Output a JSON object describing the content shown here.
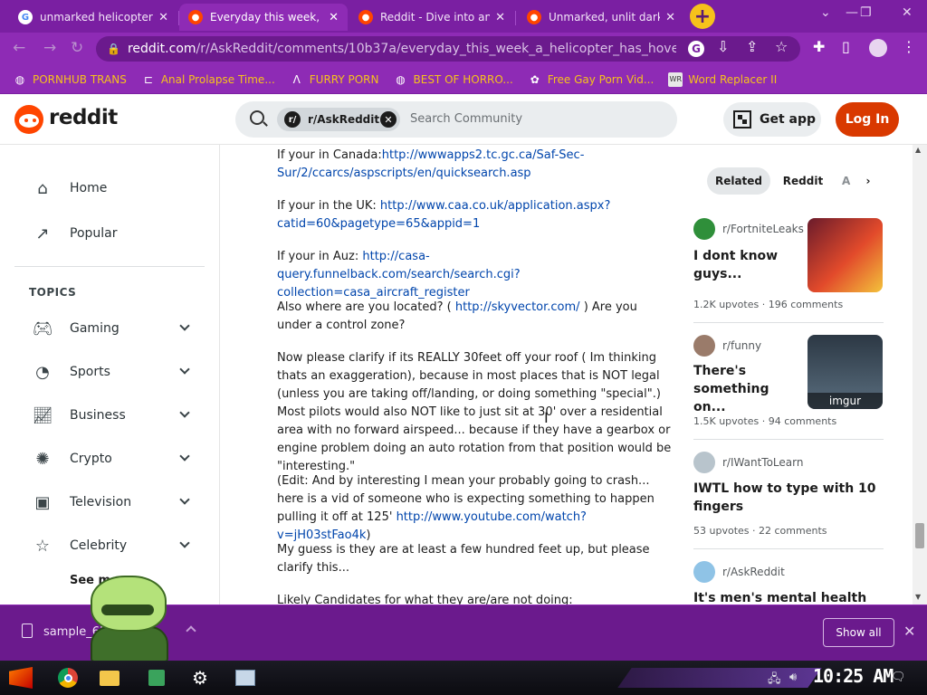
{
  "browser": {
    "tabs": [
      {
        "title": "unmarked helicopter",
        "icon": "google-icon",
        "active": false
      },
      {
        "title": "Everyday this week, a",
        "icon": "reddit-icon",
        "active": true
      },
      {
        "title": "Reddit - Dive into an",
        "icon": "reddit-icon",
        "active": false
      },
      {
        "title": "Unmarked, unlit dark",
        "icon": "reddit-icon",
        "active": false
      }
    ],
    "new_tab": "+",
    "url_host": "reddit.com",
    "url_path": "/r/AskReddit/comments/10b37a/everyday_this_week_a_helicopter_has_hover...",
    "bookmarks": [
      {
        "label": "PORNHUB TRANS",
        "icon": "globe-icon"
      },
      {
        "label": "Anal Prolapse Time...",
        "icon": "bookmark-icon"
      },
      {
        "label": "FURRY PORN",
        "icon": "caret-logo-icon"
      },
      {
        "label": "BEST OF HORRO...",
        "icon": "globe-icon"
      },
      {
        "label": "Free Gay Porn Vid...",
        "icon": "puzzle-icon"
      },
      {
        "label": "Word Replacer II",
        "icon": "wr-icon"
      }
    ]
  },
  "reddit": {
    "brand": "reddit",
    "search_chip": "r/AskReddit",
    "search_placeholder": "Search Community",
    "get_app": "Get app",
    "login": "Log In",
    "nav": {
      "home": "Home",
      "popular": "Popular",
      "topics_heading": "TOPICS",
      "topics": [
        "Gaming",
        "Sports",
        "Business",
        "Crypto",
        "Television",
        "Celebrity"
      ],
      "see_more": "See more"
    },
    "comment": {
      "p1_prefix": "If your in Canada:",
      "p1_link": "http://wwwapps2.tc.gc.ca/Saf-Sec-Sur/2/ccarcs/aspscripts/en/quicksearch.asp",
      "p2_prefix": "If your in the UK: ",
      "p2_link": "http://www.caa.co.uk/application.aspx?catid=60&pagetype=65&appid=1",
      "p3_prefix": "If your in Auz: ",
      "p3_link": "http://casa-query.funnelback.com/search/search.cgi?collection=casa_aircraft_register",
      "p4_prefix": "Also where are you located? ( ",
      "p4_link": "http://skyvector.com/",
      "p4_suffix": " ) Are you under a control zone?",
      "p5": "Now please clarify if its REALLY 30feet off your roof ( Im thinking thats an exaggeration), because in most places that is NOT legal (unless you are taking off/landing, or doing something \"special\".) Most pilots would also NOT like to just sit at 30' over a residential area with no forward airspeed... because if they have a gearbox or engine problem doing an auto rotation from that position would be \"interesting.\"",
      "p6_prefix": "(Edit: And by interesting I mean your probably going to crash... here is a vid of someone who is expecting something to happen pulling it off at 125' ",
      "p6_link": "http://www.youtube.com/watch?v=jH03stFao4k",
      "p6_suffix": ")",
      "p7": "My guess is they are at least a few hundred feet up, but please clarify this...",
      "p8": "Likely Candidates for what they are/are not doing:"
    },
    "related": {
      "tabs": [
        "Related",
        "Reddit",
        "A"
      ],
      "posts": [
        {
          "sub": "r/FortniteLeaks",
          "title": "I dont know guys...",
          "upvotes": "1.2K upvotes",
          "comments": "196 comments",
          "thumb_label": ""
        },
        {
          "sub": "r/funny",
          "title": "There's something on...",
          "upvotes": "1.5K upvotes",
          "comments": "94 comments",
          "thumb_label": "imgur"
        },
        {
          "sub": "r/IWantToLearn",
          "title": "IWTL how to type with 10 fingers",
          "upvotes": "53 upvotes",
          "comments": "22 comments",
          "thumb_label": ""
        },
        {
          "sub": "r/AskReddit",
          "title": "It's men's mental health",
          "upvotes": "",
          "comments": "",
          "thumb_label": ""
        }
      ]
    }
  },
  "downloads": {
    "file": "sample_6515c...jpg",
    "show_all": "Show all"
  },
  "taskbar": {
    "clock": "10:25 AM"
  },
  "colors": {
    "chrome_purple": "#8e2bb5",
    "reddit_orange": "#ff4500",
    "login_bg": "#d93900",
    "link": "#0045ac"
  }
}
